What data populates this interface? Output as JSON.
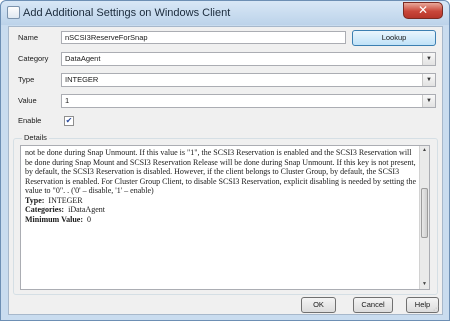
{
  "window": {
    "title": "Add Additional Settings on Windows Client",
    "close_glyph": "✕"
  },
  "form": {
    "name": {
      "label": "Name",
      "value": "nSCSI3ReserveForSnap",
      "lookup_label": "Lookup"
    },
    "category": {
      "label": "Category",
      "value": "DataAgent"
    },
    "type": {
      "label": "Type",
      "value": "INTEGER"
    },
    "value": {
      "label": "Value",
      "value": "1"
    },
    "enable": {
      "label": "Enable",
      "checked": true,
      "check_glyph": "✔"
    }
  },
  "details": {
    "label": "Details",
    "paragraph": "not be done during Snap Unmount. If this value is \"1\", the SCSI3 Reservation is enabled and the SCSI3 Reservation will be done during Snap Mount and SCSI3 Reservation Release will be done during Snap Unmount. If this key is not present, by default, the SCSI3 Reservation is disabled. However, if the client belongs to Cluster Group, by default, the SCSI3 Reservation is enabled. For Cluster Group Client, to disable SCSI3 Reservation, explicit disabling is needed by setting the value to \"0\". . ('0' – disable, '1' – enable)",
    "type_key": "Type:",
    "type_val": "INTEGER",
    "categories_key": "Categories:",
    "categories_val": "iDataAgent",
    "minimum_key": "Minimum Value:",
    "minimum_val": "0",
    "scroll_up": "▲",
    "scroll_down": "▼"
  },
  "buttons": {
    "ok": "OK",
    "cancel": "Cancel",
    "help": "Help"
  },
  "icons": {
    "combo_arrow": "▼",
    "grip": "⋰"
  }
}
